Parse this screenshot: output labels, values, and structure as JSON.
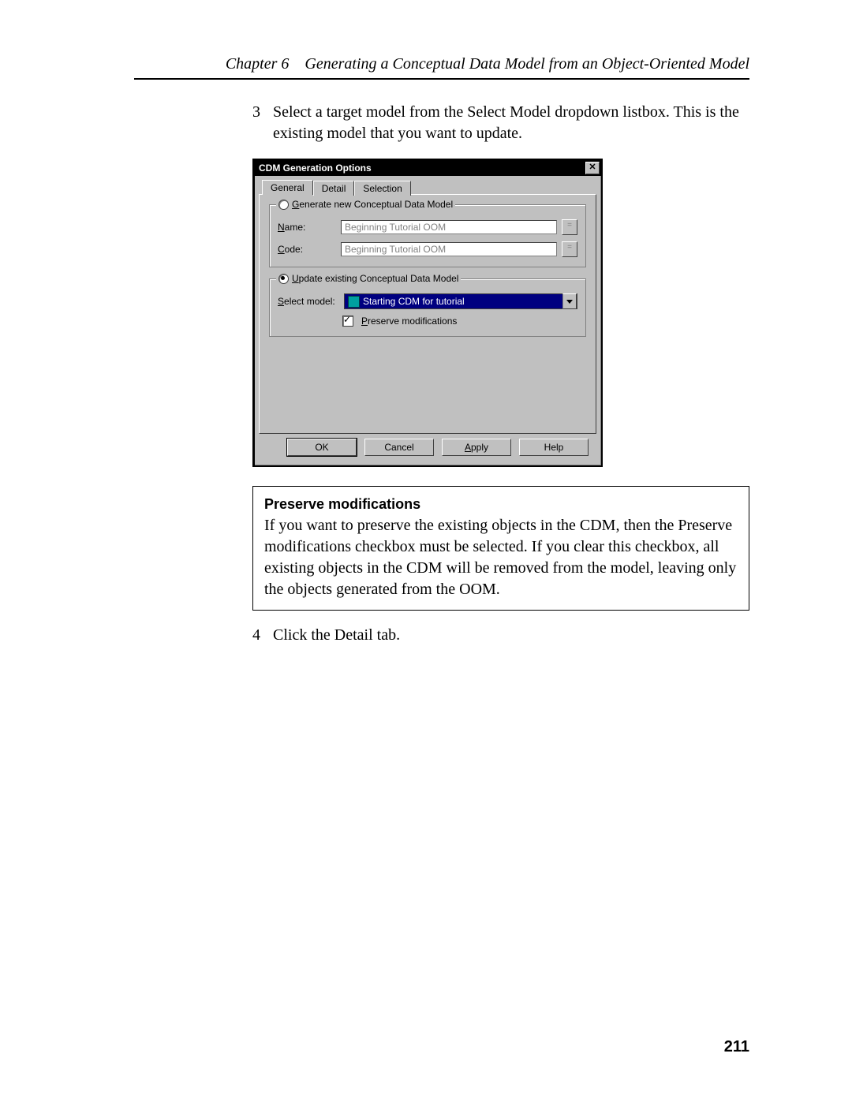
{
  "header": {
    "chapter_label": "Chapter 6",
    "chapter_title": "Generating a Conceptual Data Model from an Object-Oriented Model"
  },
  "page_number": "211",
  "steps": [
    {
      "num": "3",
      "text": "Select a target model from the Select Model dropdown listbox. This is the existing model that you want to update."
    },
    {
      "num": "4",
      "text": "Click the Detail tab."
    }
  ],
  "note": {
    "heading": "Preserve modifications",
    "body": "If you want to preserve the existing objects in the CDM, then the Preserve modifications checkbox must be selected. If you clear this checkbox, all existing objects in the CDM will be removed from the model, leaving only the objects generated from the OOM."
  },
  "dialog": {
    "title": "CDM Generation Options",
    "close_glyph": "✕",
    "tabs": {
      "general": "General",
      "detail": "Detail",
      "selection": "Selection",
      "active": "general"
    },
    "group_generate": {
      "legend_text": "Generate new Conceptual Data Model",
      "legend_accel": "G",
      "selected": false,
      "name_label": "Name:",
      "name_accel": "N",
      "name_value": "Beginning Tutorial OOM",
      "code_label": "Code:",
      "code_accel": "C",
      "code_value": "Beginning Tutorial OOM"
    },
    "group_update": {
      "legend_text": "Update existing Conceptual Data Model",
      "legend_accel": "U",
      "selected": true,
      "select_label": "Select model:",
      "select_accel": "S",
      "select_value": "Starting CDM for tutorial",
      "preserve_label": "Preserve modifications",
      "preserve_accel": "P",
      "preserve_checked": true
    },
    "buttons": {
      "ok": "OK",
      "cancel": "Cancel",
      "apply": "Apply",
      "apply_accel": "A",
      "help": "Help"
    }
  }
}
